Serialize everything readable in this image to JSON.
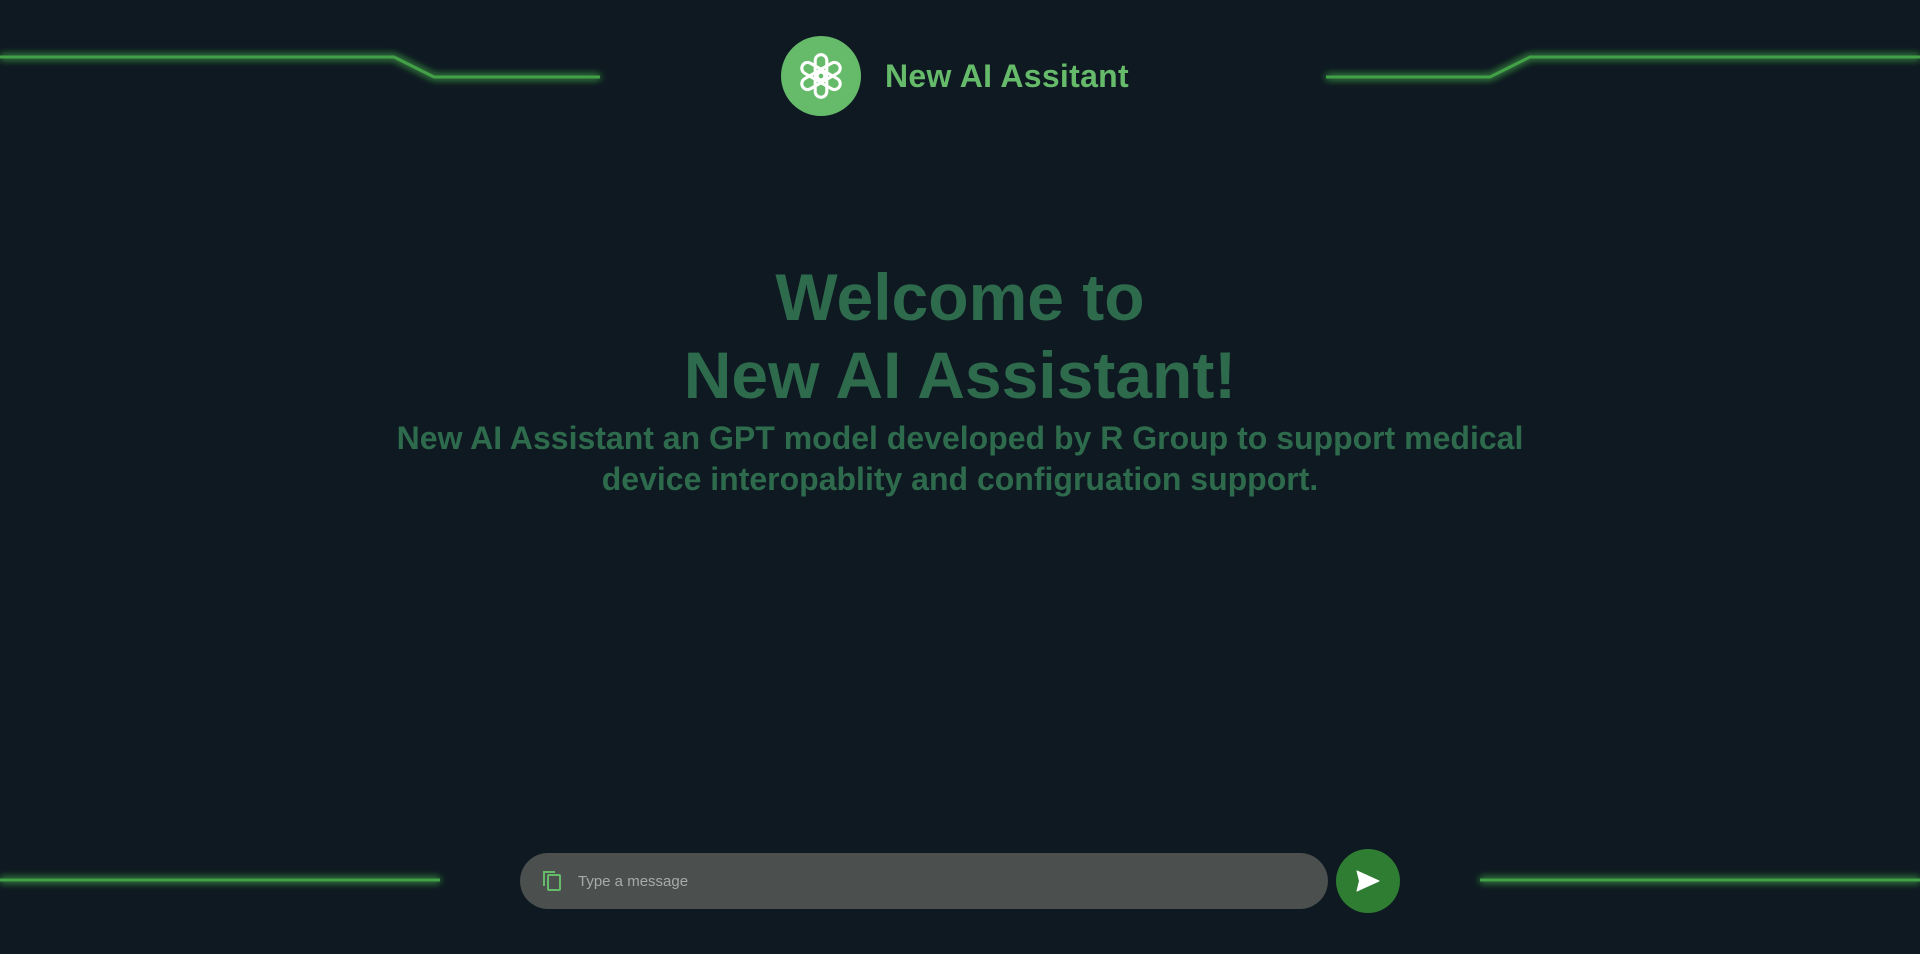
{
  "header": {
    "logo_icon": "openai-knot-icon",
    "title": "New AI Assitant"
  },
  "welcome": {
    "line1": "Welcome to",
    "line2": "New AI Assistant!",
    "description": "New AI Assistant an GPT model developed by R Group to support medical device interopablity and configruation support."
  },
  "composer": {
    "attach_icon": "copy-icon",
    "placeholder": "Type a message",
    "value": "",
    "send_icon": "send-icon"
  },
  "colors": {
    "background": "#0f1922",
    "accent": "#66bb6a",
    "circuit": "#4caf50",
    "welcome_text": "#2e6b4c",
    "input_bg": "#4b504f",
    "send_button": "#2e7d32"
  }
}
